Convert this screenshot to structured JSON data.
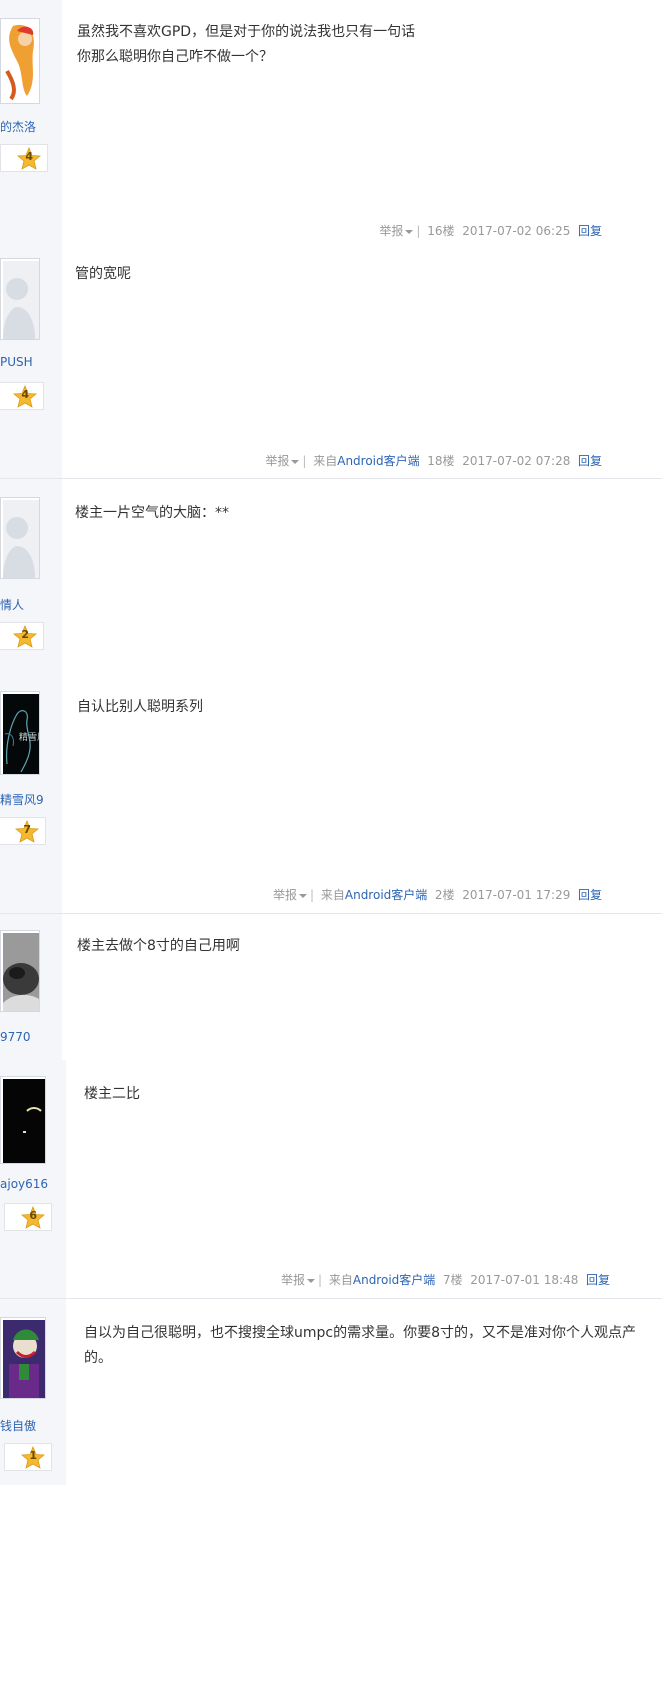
{
  "posts": [
    {
      "username": "的杰洛",
      "level": "4",
      "content": [
        "虽然我不喜欢GPD，但是对于你的说法我也只有一句话",
        "你那么聪明你自己咋不做一个？"
      ],
      "meta": {
        "report": "举报",
        "source_prefix": "",
        "source": "",
        "floor": "16楼",
        "time": "2017-07-02 06:25",
        "reply": "回复"
      }
    },
    {
      "username": "PUSH",
      "level": "4",
      "content": [
        "管的宽呢"
      ],
      "meta": {
        "report": "举报",
        "source_prefix": "来自",
        "source": "Android客户端",
        "floor": "18楼",
        "time": "2017-07-02 07:28",
        "reply": "回复"
      }
    },
    {
      "username": "情人",
      "level": "2",
      "content": [
        "楼主一片空气的大脑：**"
      ]
    },
    {
      "username": "精雪风9",
      "level": "7",
      "avatar_text": "精雪風",
      "content": [
        "自认比别人聪明系列"
      ],
      "meta": {
        "report": "举报",
        "source_prefix": "来自",
        "source": "Android客户端",
        "floor": "2楼",
        "time": "2017-07-01 17:29",
        "reply": "回复"
      }
    },
    {
      "username": "9770",
      "content": [
        "楼主去做个8寸的自己用啊"
      ]
    },
    {
      "username": "ajoy616",
      "level": "6",
      "content": [
        "楼主二比"
      ],
      "meta": {
        "report": "举报",
        "source_prefix": "来自",
        "source": "Android客户端",
        "floor": "7楼",
        "time": "2017-07-01 18:48",
        "reply": "回复"
      }
    },
    {
      "username": "钱自傲",
      "level": "1",
      "content": [
        "自以为自己很聪明，也不搜搜全球umpc的需求量。你要8寸的，又不是准对你个人观点产",
        "的。"
      ]
    }
  ],
  "colors": {
    "link": "#2d64b3",
    "meta": "#999999",
    "sidebar": "#f4f6f9",
    "star": "#f5b82e"
  },
  "icons": [
    "star-badge-icon",
    "dropdown-caret-icon",
    "default-avatar-icon"
  ]
}
